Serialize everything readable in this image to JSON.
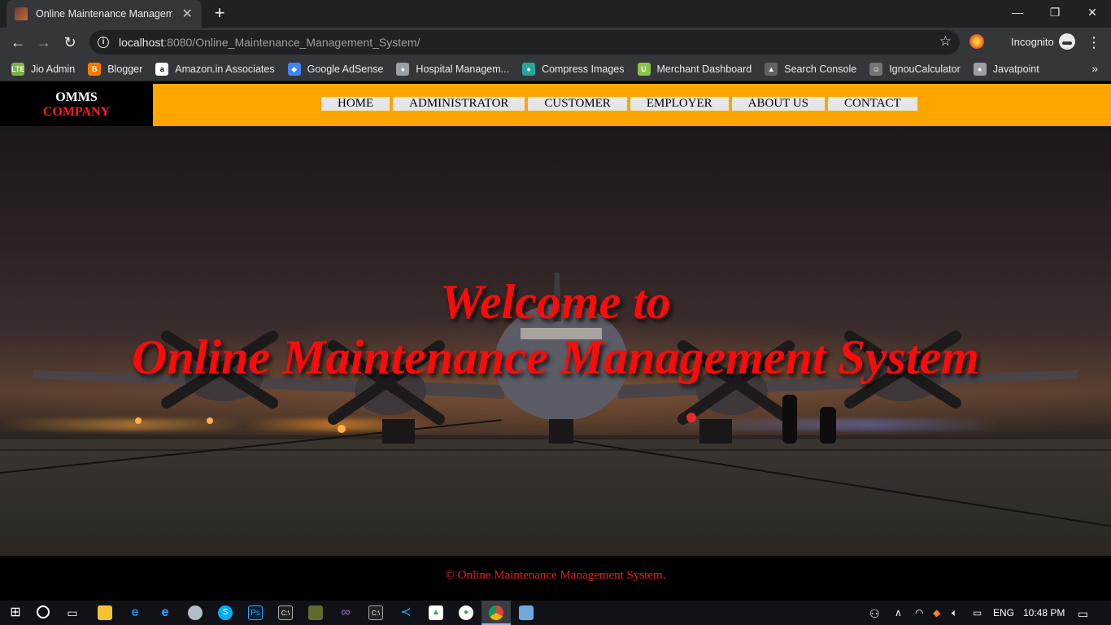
{
  "browser": {
    "tab_title": "Online Maintenance Management System",
    "url_host": "localhost",
    "url_rest": ":8080/Online_Maintenance_Management_System/",
    "incognito_label": "Incognito",
    "bookmarks": [
      {
        "label": "Jio Admin",
        "icon": "jio-icon",
        "color": "#7cb342",
        "glyph": "LTE"
      },
      {
        "label": "Blogger",
        "icon": "blogger-icon",
        "color": "#f57c00",
        "glyph": "B"
      },
      {
        "label": "Amazon.in Associates",
        "icon": "amazon-icon",
        "color": "#ffffff",
        "glyph": "a"
      },
      {
        "label": "Google AdSense",
        "icon": "adsense-icon",
        "color": "#4285f4",
        "glyph": "◆"
      },
      {
        "label": "Hospital Managem...",
        "icon": "globe-icon",
        "color": "#9aa0a6",
        "glyph": "●"
      },
      {
        "label": "Compress Images",
        "icon": "compress-icon",
        "color": "#26a69a",
        "glyph": "●"
      },
      {
        "label": "Merchant Dashboard",
        "icon": "merchant-icon",
        "color": "#8bc34a",
        "glyph": "U"
      },
      {
        "label": "Search Console",
        "icon": "search-console-icon",
        "color": "#5f6368",
        "glyph": "▲"
      },
      {
        "label": "IgnouCalculator",
        "icon": "ignou-icon",
        "color": "#757575",
        "glyph": "☺"
      },
      {
        "label": "Javatpoint",
        "icon": "globe-icon",
        "color": "#9aa0a6",
        "glyph": "●"
      }
    ]
  },
  "site": {
    "logo_line1": "OMMS",
    "logo_line2": "COMPANY",
    "nav": [
      "HOME",
      "ADMINISTRATOR",
      "CUSTOMER",
      "EMPLOYER",
      "ABOUT US",
      "CONTACT"
    ],
    "hero_line1": "Welcome to",
    "hero_line2": "Online Maintenance Management System",
    "footer": "© Online Maintenance Management System."
  },
  "taskbar": {
    "language": "ENG",
    "time": "10:48 PM"
  },
  "colors": {
    "header_bg": "#ffa500",
    "hero_text": "#ff0a0a",
    "footer_text": "#e31b1b"
  }
}
